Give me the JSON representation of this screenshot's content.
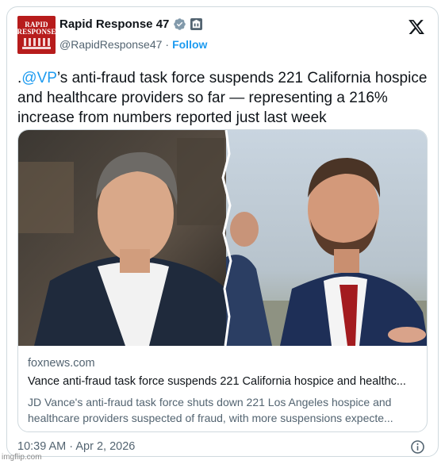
{
  "account": {
    "display_name": "Rapid Response 47",
    "handle": "@RapidResponse47",
    "separator": "·",
    "follow_label": "Follow",
    "avatar_text_line1": "RAPID",
    "avatar_text_line2": "RESPONSE",
    "avatar_icon": "white-house-logo"
  },
  "icons": {
    "verified": "verified-badge-icon",
    "org_badge": "government-org-icon",
    "platform": "x-logo-icon",
    "info": "info-icon"
  },
  "tweet": {
    "prefix": ".",
    "mention": "@VP",
    "body": "’s anti-fraud task force suspends 221 California hospice and healthcare providers so far — representing a 216% increase from numbers reported just last week",
    "timestamp": "10:39 AM · Apr 2, 2026"
  },
  "link_card": {
    "domain": "foxnews.com",
    "title": "Vance anti-fraud task force suspends 221 California hospice and healthc...",
    "description": "JD Vance's anti-fraud task force shuts down 221 Los Angeles hospice and healthcare providers suspected of fraud, with more suspensions expecte..."
  },
  "watermark": "imgflip.com",
  "colors": {
    "accent": "#1d9bf0",
    "text": "#0f1419",
    "secondary": "#536471",
    "border": "#cfd9de",
    "avatar_bg": "#b71c1c"
  }
}
